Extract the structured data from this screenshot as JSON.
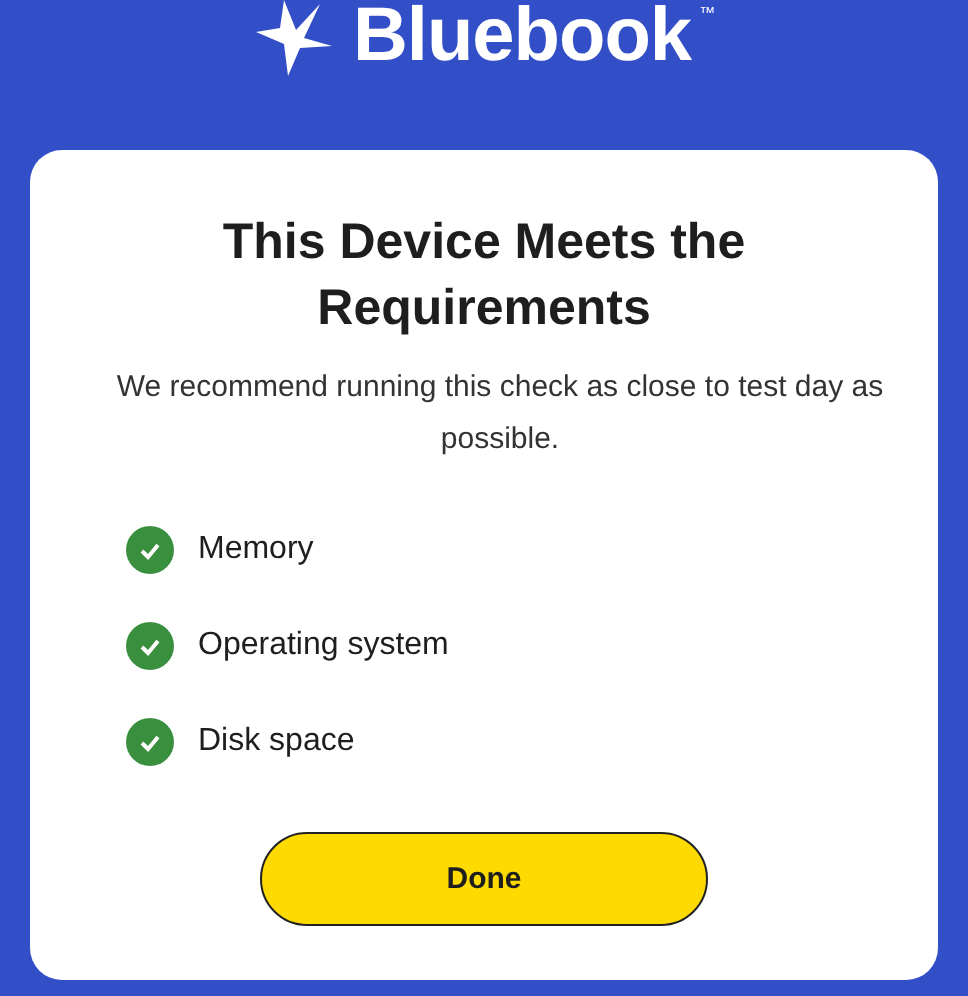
{
  "header": {
    "logo_text": "Bluebook",
    "trademark": "™"
  },
  "card": {
    "title": "This Device Meets the Requirements",
    "message": "We recommend running this check as close to test day as possible.",
    "checks": [
      {
        "label": "Memory",
        "passed": true
      },
      {
        "label": "Operating system",
        "passed": true
      },
      {
        "label": "Disk space",
        "passed": true
      }
    ],
    "button": "Done"
  }
}
